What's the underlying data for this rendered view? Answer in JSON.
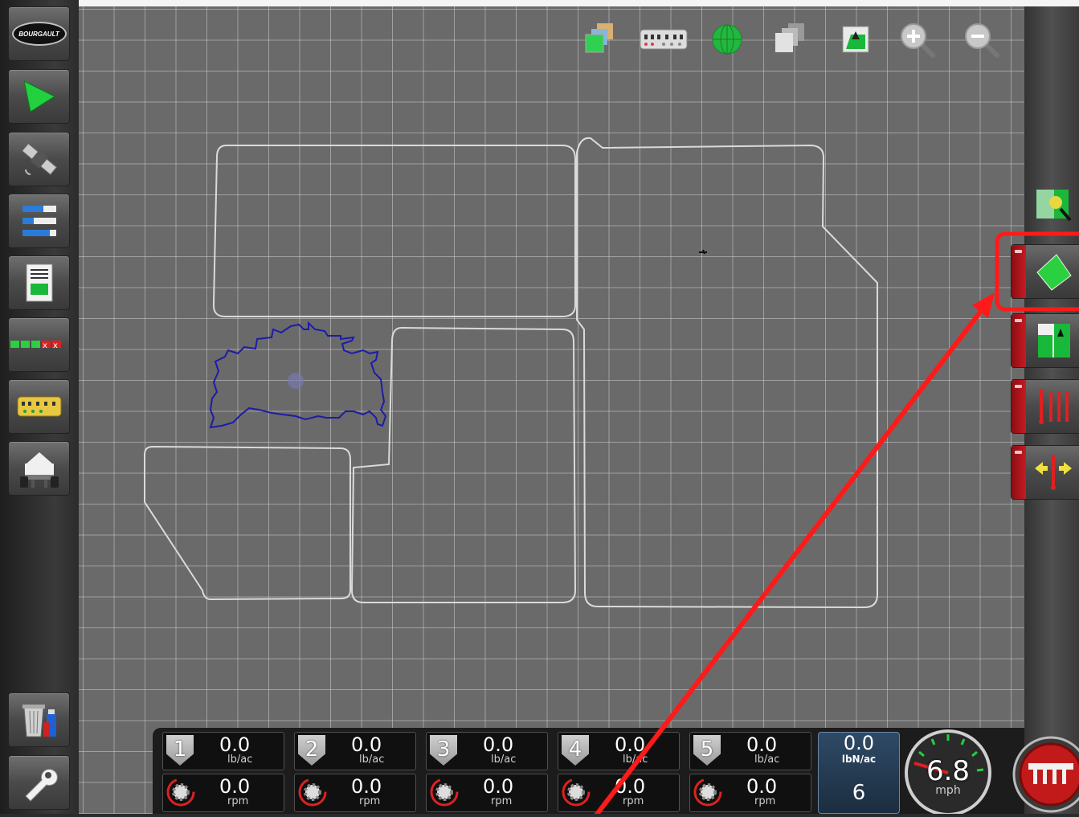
{
  "brand": {
    "logo_text": "BOURGAULT"
  },
  "left_toolbar": [
    {
      "name": "bourgault-logo-button"
    },
    {
      "name": "guidance-button"
    },
    {
      "name": "gps-satellite-button"
    },
    {
      "name": "product-list-button"
    },
    {
      "name": "report-button"
    },
    {
      "name": "section-status-button"
    },
    {
      "name": "implement-sections-button"
    },
    {
      "name": "cart-button"
    },
    {
      "name": "delete-data-button"
    },
    {
      "name": "settings-button"
    }
  ],
  "top_toolbar": [
    {
      "name": "map-layers-icon"
    },
    {
      "name": "section-control-icon"
    },
    {
      "name": "globe-icon"
    },
    {
      "name": "map-pages-icon"
    },
    {
      "name": "field-view-icon"
    },
    {
      "name": "zoom-in-icon"
    },
    {
      "name": "zoom-out-icon"
    }
  ],
  "right_toolbar": [
    {
      "name": "map-magnify-button"
    },
    {
      "name": "boundary-button",
      "highlighted": true
    },
    {
      "name": "headland-button"
    },
    {
      "name": "guidance-lines-button"
    },
    {
      "name": "nudge-button"
    }
  ],
  "products": [
    {
      "number": "1",
      "rate": "0.0",
      "rate_unit": "lb/ac",
      "speed": "0.0",
      "speed_unit": "rpm"
    },
    {
      "number": "2",
      "rate": "0.0",
      "rate_unit": "lb/ac",
      "speed": "0.0",
      "speed_unit": "rpm"
    },
    {
      "number": "3",
      "rate": "0.0",
      "rate_unit": "lb/ac",
      "speed": "0.0",
      "speed_unit": "rpm"
    },
    {
      "number": "4",
      "rate": "0.0",
      "rate_unit": "lb/ac",
      "speed": "0.0",
      "speed_unit": "rpm"
    },
    {
      "number": "5",
      "rate": "0.0",
      "rate_unit": "lb/ac",
      "speed": "0.0",
      "speed_unit": "rpm"
    }
  ],
  "nitrogen": {
    "value": "0.0",
    "unit": "lbN/ac",
    "count": "6"
  },
  "speedometer": {
    "value": "6.8",
    "unit": "mph"
  },
  "colors": {
    "highlight": "#ff1a1a",
    "map_bg": "#6a6a6a",
    "boundary": "#d8d8d8",
    "coverage": "#1a1a9a",
    "accent_green": "#22c24a"
  }
}
